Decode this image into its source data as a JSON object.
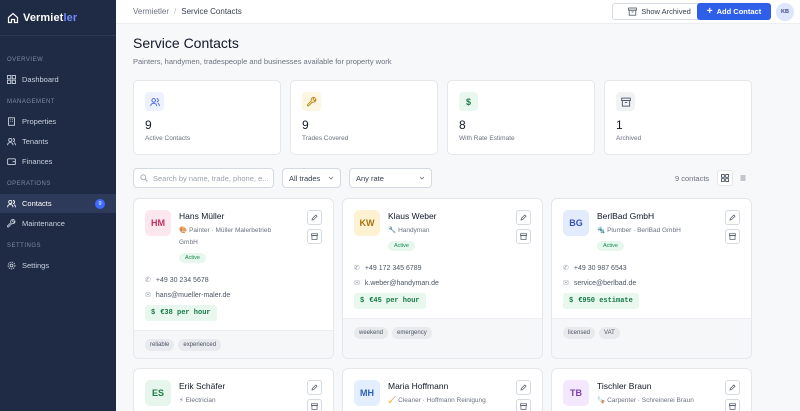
{
  "app": {
    "brand_main": "Vermiet",
    "brand_accent": "ler"
  },
  "sidebar": {
    "sections": [
      {
        "label": "Overview",
        "items": [
          {
            "label": "Dashboard",
            "icon": "grid-icon"
          }
        ]
      },
      {
        "label": "Management",
        "items": [
          {
            "label": "Properties",
            "icon": "building-icon"
          },
          {
            "label": "Tenants",
            "icon": "users-icon"
          },
          {
            "label": "Finances",
            "icon": "wallet-icon"
          }
        ]
      },
      {
        "label": "Operations",
        "items": [
          {
            "label": "Contacts",
            "icon": "contacts-icon",
            "active": true,
            "badge": "9"
          },
          {
            "label": "Maintenance",
            "icon": "wrench-icon"
          }
        ]
      },
      {
        "label": "Settings",
        "items": [
          {
            "label": "Settings",
            "icon": "gear-icon"
          }
        ]
      }
    ]
  },
  "topbar": {
    "breadcrumb": [
      "Vermietler",
      "Service Contacts"
    ],
    "show_archived_label": "Show Archived",
    "add_contact_label": "Add Contact",
    "user_initials": "KB"
  },
  "page": {
    "title": "Service Contacts",
    "subtitle": "Painters, handymen, tradespeople and businesses available for property work"
  },
  "stats": [
    {
      "value": "9",
      "label": "Active Contacts",
      "icon": "users-icon",
      "color": "#eef2ff"
    },
    {
      "value": "9",
      "label": "Trades Covered",
      "icon": "wrench-icon",
      "color": "#fdf6e3"
    },
    {
      "value": "8",
      "label": "With Rate Estimate",
      "icon": "dollar-icon",
      "color": "#e9f8ef"
    },
    {
      "value": "1",
      "label": "Archived",
      "icon": "archive-icon",
      "color": "#f1f2f4"
    }
  ],
  "filters": {
    "search_placeholder": "Search by name, trade, phone, e...",
    "trade_select": "All trades",
    "rate_select": "Any rate",
    "count_text": "9 contacts"
  },
  "contacts": [
    {
      "initials": "HM",
      "name": "Hans Müller",
      "trade_emoji": "🎨",
      "trade": "Painter · Müller Malerbetrieb GmbH",
      "status": "Active",
      "phone": "+49 30 234 5678",
      "email": "hans@mueller-maler.de",
      "rate": "€38 per hour",
      "tags": [
        "reliable",
        "experienced"
      ],
      "avatar_bg": "#fde7ef",
      "avatar_fg": "#c0335f"
    },
    {
      "initials": "KW",
      "name": "Klaus Weber",
      "trade_emoji": "🔧",
      "trade": "Handyman",
      "status": "Active",
      "phone": "+49 172 345 6789",
      "email": "k.weber@handyman.de",
      "rate": "€45 per hour",
      "tags": [
        "weekend",
        "emergency"
      ],
      "avatar_bg": "#fdf3d2",
      "avatar_fg": "#a5760f"
    },
    {
      "initials": "BG",
      "name": "BerlBad GmbH",
      "trade_emoji": "🔩",
      "trade": "Plumber · BerlBad GmbH",
      "status": "Active",
      "phone": "+49 30 987 6543",
      "email": "service@berlbad.de",
      "rate": "€950 estimate",
      "tags": [
        "licensed",
        "VAT"
      ],
      "avatar_bg": "#e3ebff",
      "avatar_fg": "#3552b4"
    },
    {
      "initials": "ES",
      "name": "Erik Schäfer",
      "trade_emoji": "⚡",
      "trade": "Electrician",
      "avatar_bg": "#e6f6ec",
      "avatar_fg": "#1d7a47"
    },
    {
      "initials": "MH",
      "name": "Maria Hoffmann",
      "trade_emoji": "🧹",
      "trade": "Cleaner · Hoffmann Reinigung",
      "avatar_bg": "#e3efff",
      "avatar_fg": "#2f5fb4"
    },
    {
      "initials": "TB",
      "name": "Tischler Braun",
      "trade_emoji": "🪚",
      "trade": "Carpenter · Schreinerei Braun",
      "avatar_bg": "#f3e8ff",
      "avatar_fg": "#7a3fb4"
    }
  ]
}
